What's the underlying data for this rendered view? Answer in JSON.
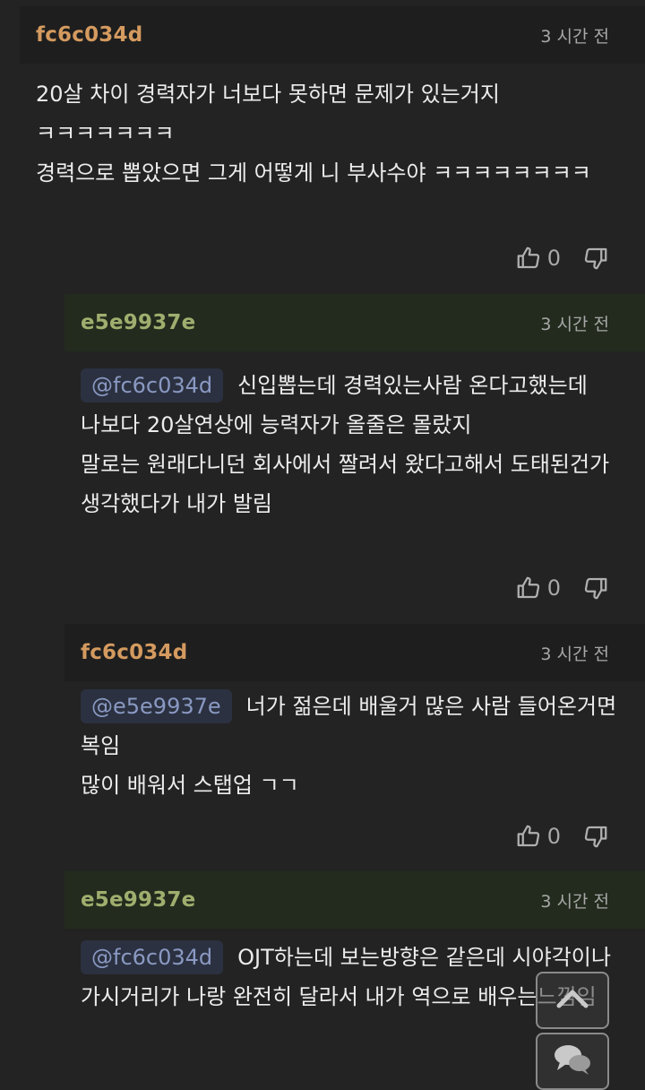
{
  "comments": [
    {
      "author": "fc6c034d",
      "time": "3 시간 전",
      "mention": "",
      "lines": [
        "20살 차이 경력자가 너보다 못하면 문제가 있는거지 ㅋㅋㅋㅋㅋㅋㅋ",
        "경력으로 뽑았으면 그게 어떻게 니 부사수야 ㅋㅋㅋㅋㅋㅋㅋㅋ"
      ],
      "likes": "0"
    },
    {
      "author": "e5e9937e",
      "time": "3 시간 전",
      "mention": "@fc6c034d",
      "lines": [
        "신입뽑는데 경력있는사람 온다고했는데",
        "나보다 20살연상에 능력자가 올줄은 몰랐지",
        "말로는 원래다니던 회사에서 짤려서 왔다고해서 도태된건가 생각했다가 내가 발림"
      ],
      "likes": "0"
    },
    {
      "author": "fc6c034d",
      "time": "3 시간 전",
      "mention": "@e5e9937e",
      "lines": [
        "너가 젊은데 배울거 많은 사람 들어온거면 복임",
        "많이 배워서 스탭업 ㄱㄱ"
      ],
      "likes": "0"
    },
    {
      "author": "e5e9937e",
      "time": "3 시간 전",
      "mention": "@fc6c034d",
      "lines": [
        "OJT하는데 보는방향은 같은데 시야각이나 가시거리가 나랑 완전히 달라서 내가 역으로 배우는느낌임"
      ],
      "likes": ""
    }
  ],
  "icons": {
    "like": "thumbs-up-icon",
    "dislike": "thumbs-down-icon",
    "scroll_top": "chevron-up-icon",
    "chat": "chat-bubbles-icon"
  },
  "colors": {
    "background": "#232323",
    "author_orange": "#d49a5f",
    "author_olive": "#9fae6e",
    "reply_header": "#222b1d",
    "mention_bg": "#2b3140",
    "mention_text": "#8a99c3"
  }
}
